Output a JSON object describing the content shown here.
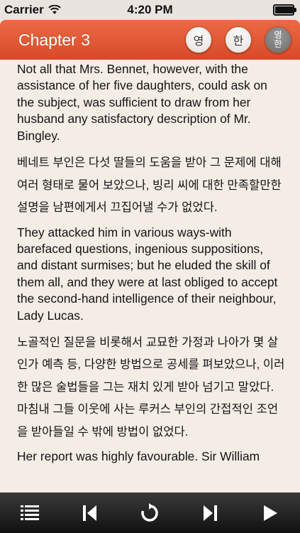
{
  "status_bar": {
    "carrier": "Carrier",
    "time": "4:20 PM",
    "battery_level": 0.95
  },
  "header": {
    "title": "Chapter 3",
    "lang_buttons": [
      {
        "label": "영"
      },
      {
        "label": "한"
      },
      {
        "label_top": "영",
        "label_bottom": "한"
      }
    ]
  },
  "content": {
    "paragraphs": [
      {
        "lang": "en",
        "text": "Not all that Mrs. Bennet, however, with the assistance of her five daughters, could ask on the subject, was sufficient to draw from her husband any satisfactory description of Mr. Bingley."
      },
      {
        "lang": "ko",
        "text": "베네트 부인은 다섯 딸들의 도움을 받아 그 문제에 대해 여러 형태로 물어 보았으나, 빙리 씨에 대한 만족할만한 설명을 남편에게서 끄집어낼 수가 없었다."
      },
      {
        "lang": "en",
        "text": "They attacked him in various ways-with barefaced questions, ingenious suppositions, and distant surmises; but he eluded the skill of them all, and they were at last obliged to accept the second-hand intelligence of their neighbour, Lady Lucas."
      },
      {
        "lang": "ko",
        "text": "노골적인 질문을 비롯해서 교묘한 가정과 나아가 몇 살인가 예측 등, 다양한 방법으로 공세를 펴보았으나, 이러한 많은 술법들을 그는 재치 있게 받아 넘기고 말았다. 마침내 그들 이웃에 사는 루커스 부인의 간접적인 조언을 받아들일 수 밖에 방법이 없었다."
      },
      {
        "lang": "en",
        "text": "Her report was highly favourable. Sir William"
      }
    ]
  },
  "toolbar": {
    "buttons": [
      {
        "icon": "list-icon"
      },
      {
        "icon": "skip-previous-icon"
      },
      {
        "icon": "repeat-icon"
      },
      {
        "icon": "skip-next-icon"
      },
      {
        "icon": "play-icon"
      }
    ]
  },
  "colors": {
    "header_accent": "#e05a33",
    "page_background": "#f4ede6",
    "toolbar": "#1e1e1e"
  }
}
